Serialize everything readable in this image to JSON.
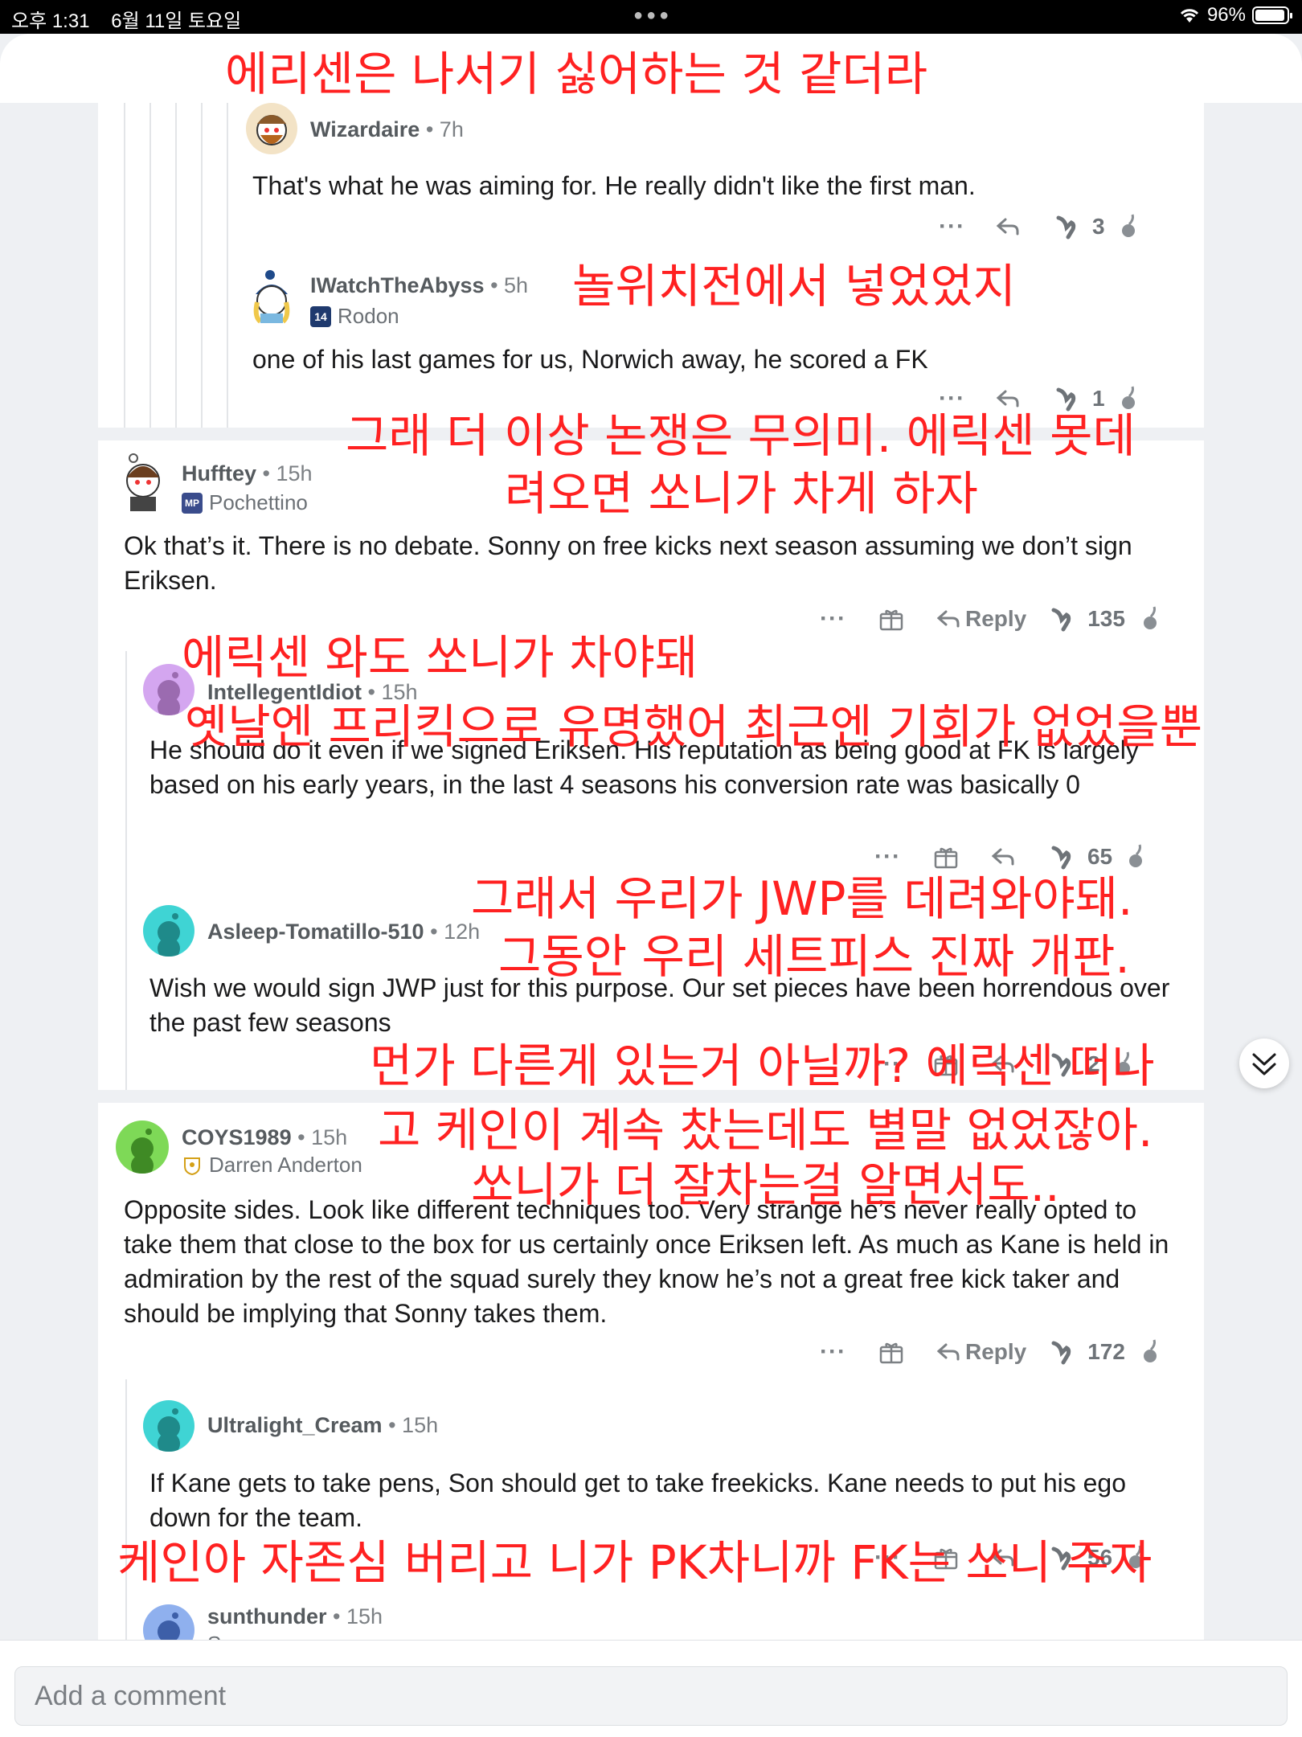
{
  "status_bar": {
    "time": "오후 1:31",
    "date": "6월 11일 토요일",
    "battery": "96%"
  },
  "comments": [
    {
      "user": "Wizardaire",
      "time": "7h",
      "flair": "",
      "body": "That's what he was aiming for. He really didn't like the first man.",
      "score": "3"
    },
    {
      "user": "IWatchTheAbyss",
      "time": "5h",
      "flair": "Rodon",
      "flair_badge": "14",
      "body": "one of his last games for us, Norwich away, he scored a FK",
      "score": "1"
    },
    {
      "user": "Hufftey",
      "time": "15h",
      "flair": "Pochettino",
      "flair_badge": "MP",
      "body": "Ok that’s it. There is no debate. Sonny on free kicks next season assuming we don’t sign Eriksen.",
      "score": "135",
      "reply": "Reply"
    },
    {
      "user": "IntellegentIdiot",
      "time": "15h",
      "flair": "",
      "body": "He should do it even if we signed Eriksen. His reputation as being good at FK is largely based on his early years, in the last 4 seasons his conversion rate was basically 0",
      "score": "65"
    },
    {
      "user": "Asleep-Tomatillo-510",
      "time": "12h",
      "flair": "",
      "body": "Wish we would sign JWP just for this purpose. Our set pieces have been horrendous over the past few seasons",
      "score": "2"
    },
    {
      "user": "COYS1989",
      "time": "15h",
      "flair": "Darren Anderton",
      "body": "Opposite sides. Look like different techniques too. Very strange he’s never really opted to take them that close to the box for us certainly once Eriksen left. As much as Kane is held in admiration by the rest of the squad surely they know he’s not a great free kick taker and should be implying that Sonny takes them.",
      "score": "172",
      "reply": "Reply"
    },
    {
      "user": "Ultralight_Cream",
      "time": "15h",
      "flair": "",
      "body": "If Kane gets to take pens, Son should get to take freekicks. Kane needs to put his ego down for the team.",
      "score": "56"
    },
    {
      "user": "sunthunder",
      "time": "15h",
      "flair": "Son"
    }
  ],
  "overlays": [
    "에리센은 나서기 싫어하는 것 같더라",
    "놀위치전에서 넣었었지",
    "그래 더 이상 논쟁은 무의미. 에릭센 못데",
    "려오면 쏘니가 차게 하자",
    "에릭센 와도 쏘니가 차야돼",
    "옛날엔 프리킥으로 유명했어 최근엔 기회가 없었을뿐",
    "그래서 우리가 JWP를 데려와야돼.",
    "그동안 우리 세트피스 진짜 개판.",
    "먼가 다른게 있는거 아닐까? 에릭센 떠나",
    "고 케인이 계속 찼는데도 별말 없었잖아.",
    "쏘니가 더 잘차는걸 알면서도..",
    "케인아 자존심 버리고 니가 PK차니까 FK는 쏘니 주자"
  ],
  "comment_input": {
    "placeholder": "Add a comment"
  },
  "colors": {
    "overlay_red": "#ff2121",
    "accent_blue": "#0079d3"
  },
  "icons": [
    "more-icon",
    "award-icon",
    "reply-icon",
    "upvote-icon",
    "downvote-icon",
    "chevron-double-down-icon"
  ]
}
